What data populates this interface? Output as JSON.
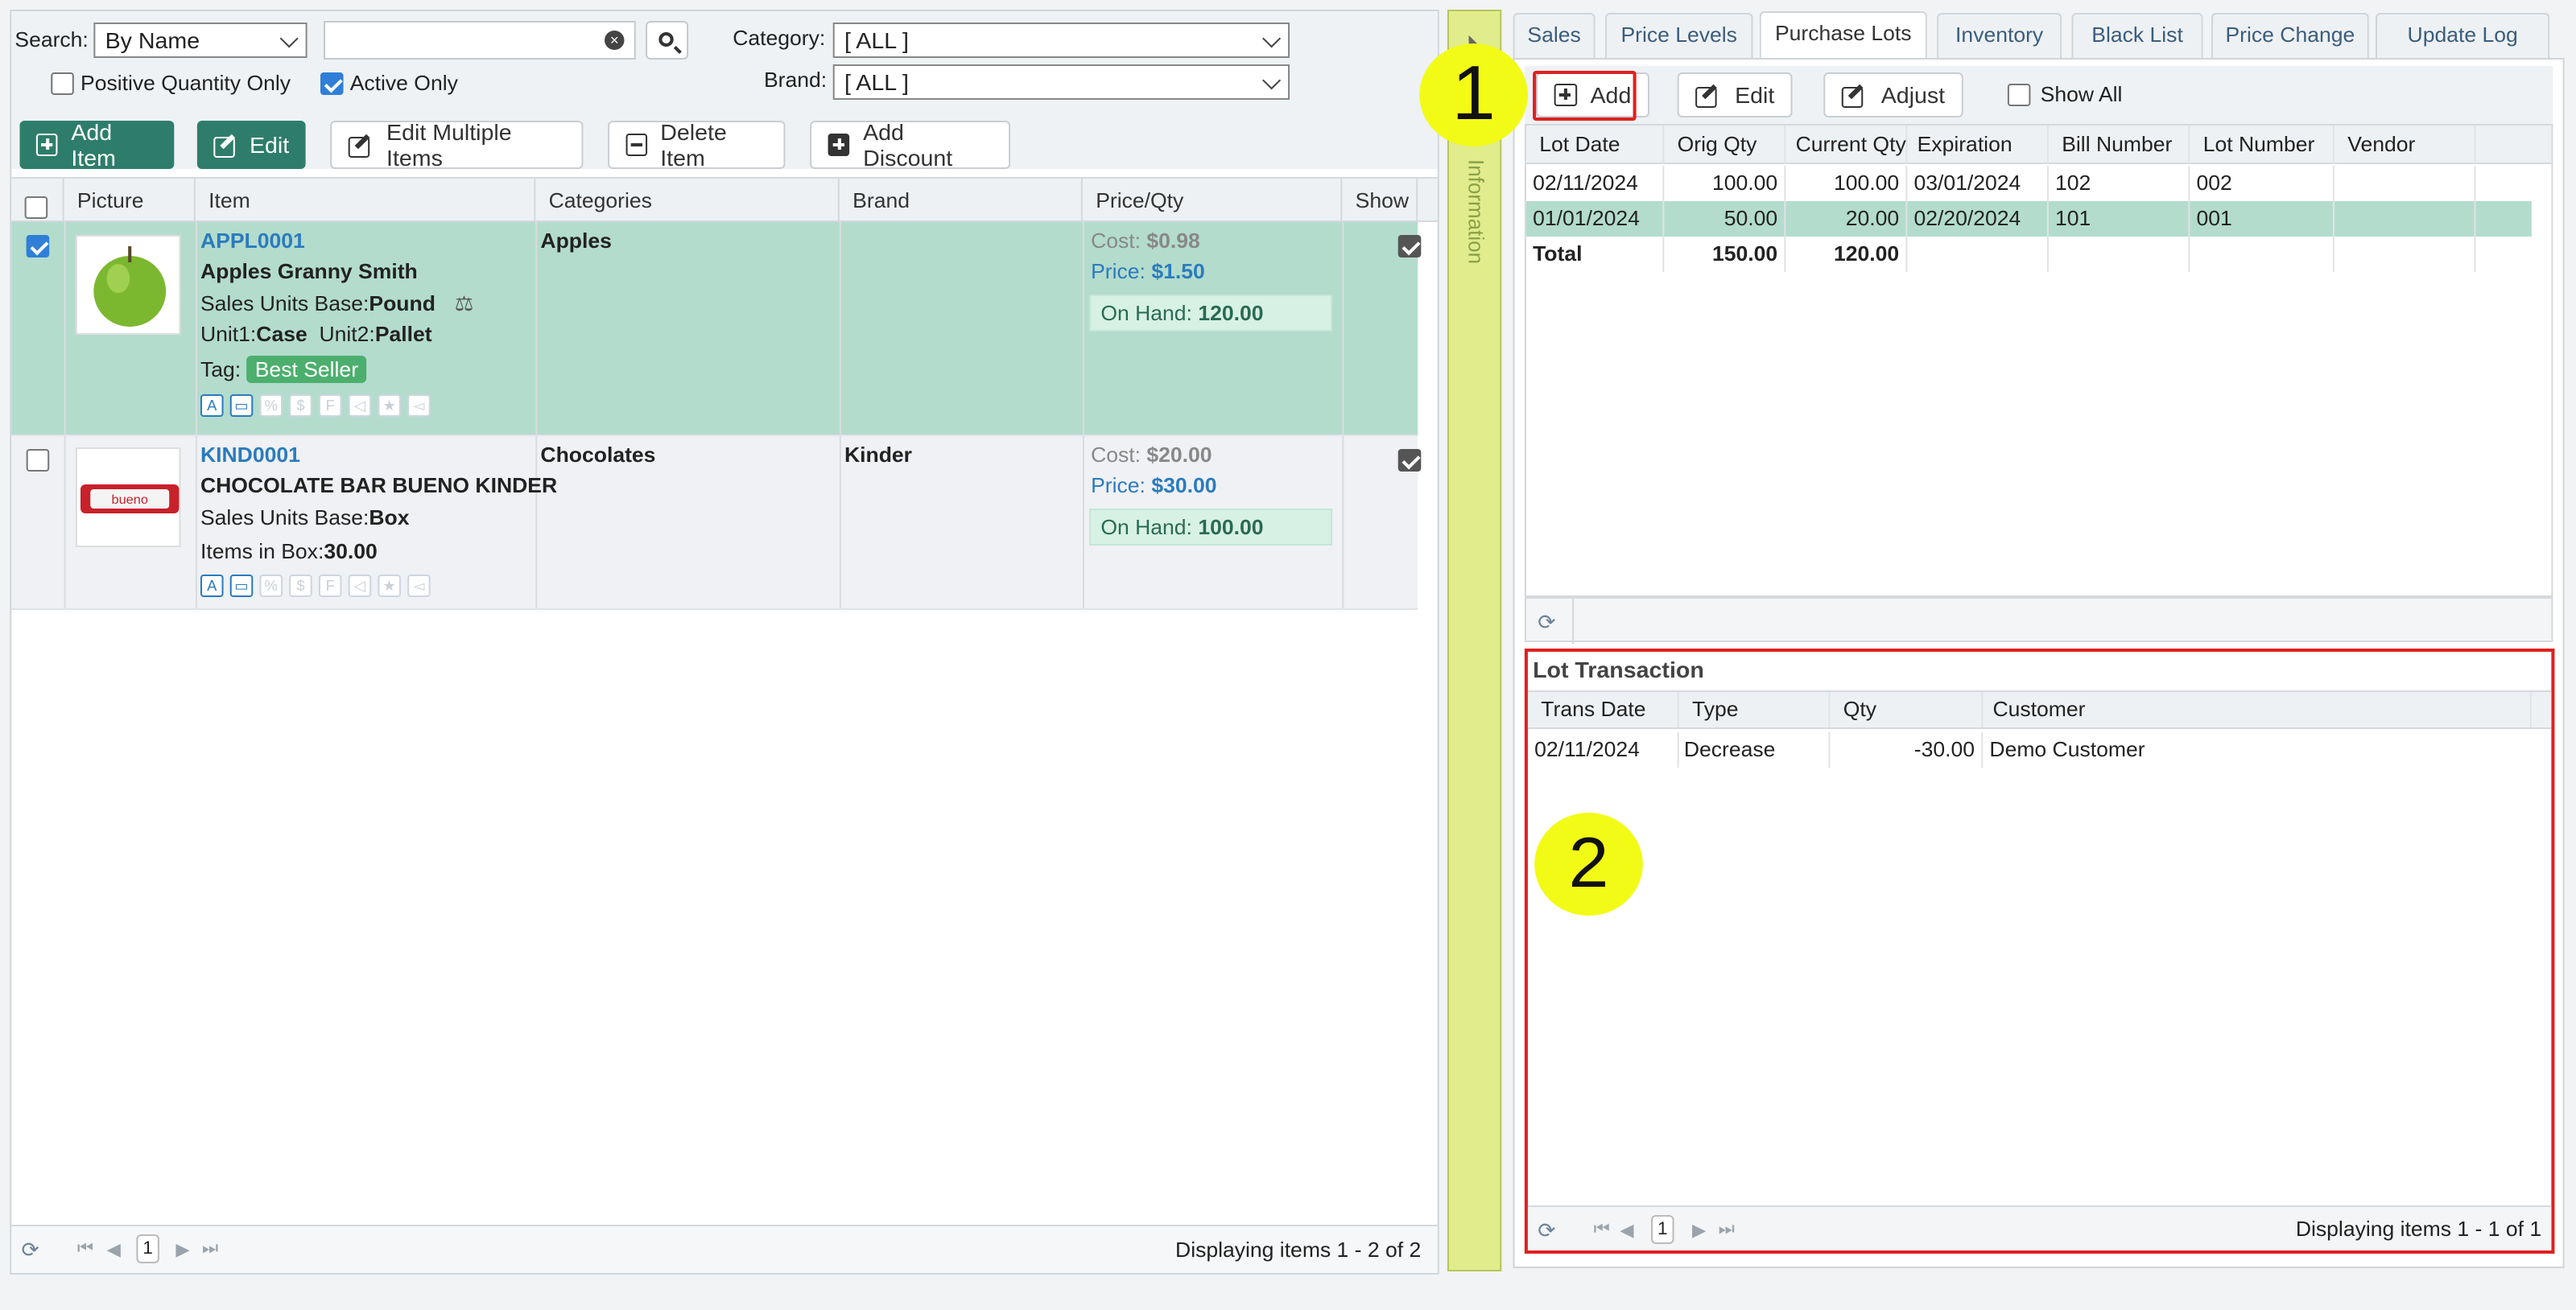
{
  "search": {
    "label": "Search:",
    "mode": "By Name",
    "query": "",
    "category_label": "Category:",
    "category_value": "[ ALL ]",
    "brand_label": "Brand:",
    "brand_value": "[ ALL ]",
    "positive_qty": "Positive Quantity Only",
    "active_only": "Active Only"
  },
  "toolbar": {
    "add_item": "Add Item",
    "edit": "Edit",
    "edit_multiple": "Edit Multiple Items",
    "delete_item": "Delete Item",
    "add_discount": "Add Discount"
  },
  "items_grid": {
    "columns": [
      "Picture",
      "Item",
      "Categories",
      "Brand",
      "Price/Qty",
      "Show"
    ],
    "rows": [
      {
        "code": "APPL0001",
        "name": "Apples Granny Smith",
        "base_label": "Sales Units Base:",
        "base_value": "Pound",
        "unit1_label": "Unit1:",
        "unit1_value": "Case",
        "unit2_label": "Unit2:",
        "unit2_value": "Pallet",
        "tag_label": "Tag:",
        "tag_value": "Best Seller",
        "category": "Apples",
        "brand": "",
        "cost_label": "Cost:",
        "cost": "$0.98",
        "price_label": "Price:",
        "price": "$1.50",
        "onhand_label": "On Hand:",
        "onhand": "120.00"
      },
      {
        "code": "KIND0001",
        "name": "CHOCOLATE BAR BUENO KINDER",
        "base_label": "Sales Units Base:",
        "base_value": "Box",
        "box_label": "Items in Box:",
        "box_value": "30.00",
        "category": "Chocolates",
        "brand": "Kinder",
        "cost_label": "Cost:",
        "cost": "$20.00",
        "price_label": "Price:",
        "price": "$30.00",
        "onhand_label": "On Hand:",
        "onhand": "100.00",
        "thumb_text": "bueno"
      }
    ],
    "pager": {
      "page": "1",
      "status": "Displaying items 1 - 2 of 2"
    }
  },
  "splitter": {
    "label": "Information"
  },
  "tabs": [
    "Sales",
    "Price Levels",
    "Purchase Lots",
    "Inventory",
    "Black List",
    "Price Change",
    "Update Log"
  ],
  "lots": {
    "add": "Add",
    "edit": "Edit",
    "adjust": "Adjust",
    "show_all": "Show All",
    "columns": [
      "Lot Date",
      "Orig Qty",
      "Current Qty",
      "Expiration",
      "Bill Number",
      "Lot Number",
      "Vendor"
    ],
    "rows": [
      {
        "lot_date": "02/11/2024",
        "orig": "100.00",
        "current": "100.00",
        "exp": "03/01/2024",
        "bill": "102",
        "lot": "002",
        "vendor": ""
      },
      {
        "lot_date": "01/01/2024",
        "orig": "50.00",
        "current": "20.00",
        "exp": "02/20/2024",
        "bill": "101",
        "lot": "001",
        "vendor": ""
      }
    ],
    "total_label": "Total",
    "total_orig": "150.00",
    "total_current": "120.00"
  },
  "lot_transaction": {
    "title": "Lot Transaction",
    "columns": [
      "Trans Date",
      "Type",
      "Qty",
      "Customer"
    ],
    "rows": [
      {
        "date": "02/11/2024",
        "type": "Decrease",
        "qty": "-30.00",
        "customer": "Demo Customer"
      }
    ],
    "pager": {
      "page": "1",
      "status": "Displaying items 1 - 1 of 1"
    }
  },
  "annotations": {
    "one": "1",
    "two": "2"
  },
  "colors": {
    "accent_green": "#2e7d6b",
    "selected_row": "#b3dccd",
    "link_blue": "#2b7bbd",
    "annotation_yellow": "#f2fb16",
    "highlight_red": "#e02020"
  }
}
